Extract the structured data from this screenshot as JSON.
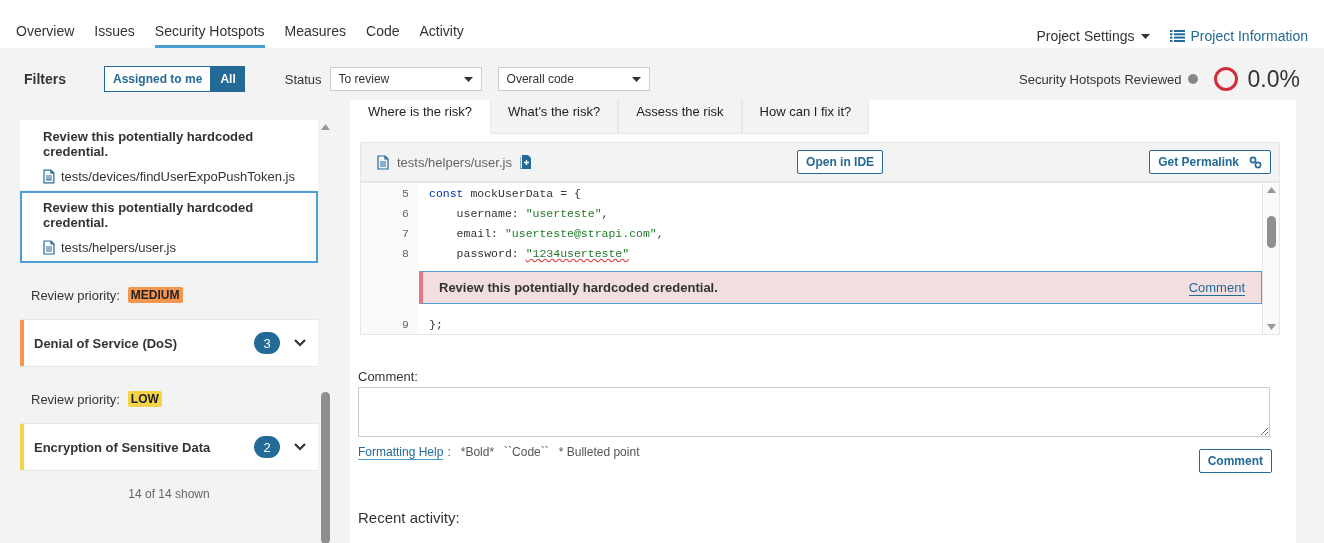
{
  "nav": {
    "tabs": [
      {
        "label": "Overview",
        "selected": false
      },
      {
        "label": "Issues",
        "selected": false
      },
      {
        "label": "Security Hotspots",
        "selected": true
      },
      {
        "label": "Measures",
        "selected": false
      },
      {
        "label": "Code",
        "selected": false
      },
      {
        "label": "Activity",
        "selected": false
      }
    ],
    "settings": "Project Settings",
    "info": "Project Information"
  },
  "filters": {
    "title": "Filters",
    "assignment": [
      {
        "label": "Assigned to me",
        "selected": false
      },
      {
        "label": "All",
        "selected": true
      }
    ],
    "status_label": "Status",
    "status": "To review",
    "scope": "Overall code",
    "reviewed_label": "Security Hotspots Reviewed",
    "reviewed_value": "0.0%"
  },
  "sidebar": {
    "items": [
      {
        "kind": "hotspot",
        "title": "Review this potentially hardcoded credential.",
        "file": "tests/devices/findUserExpoPushToken.js",
        "selected": false
      },
      {
        "kind": "hotspot",
        "title": "Review this potentially hardcoded credential.",
        "file": "tests/helpers/user.js",
        "selected": true
      },
      {
        "kind": "priority",
        "label": "Review priority:",
        "level": "MEDIUM",
        "color": "#f4964d"
      },
      {
        "kind": "category",
        "title": "Denial of Service (DoS)",
        "count": "3",
        "color": "#f4964d"
      },
      {
        "kind": "priority",
        "label": "Review priority:",
        "level": "LOW",
        "color": "#f4d348"
      },
      {
        "kind": "category",
        "title": "Encryption of Sensitive Data",
        "count": "2",
        "color": "#f4d348"
      }
    ],
    "footer": "14 of 14 shown"
  },
  "detail": {
    "tabs": [
      {
        "label": "Where is the risk?",
        "selected": true
      },
      {
        "label": "What's the risk?",
        "selected": false
      },
      {
        "label": "Assess the risk",
        "selected": false
      },
      {
        "label": "How can I fix it?",
        "selected": false
      }
    ],
    "file": "tests/helpers/user.js",
    "open_ide": "Open in IDE",
    "permalink": "Get Permalink",
    "code": [
      {
        "kind": "line",
        "number": "5",
        "tokens": [
          {
            "kind": "keyword",
            "text": "const"
          },
          {
            "kind": "plain",
            "text": " mockUserData = {"
          }
        ]
      },
      {
        "kind": "line",
        "number": "6",
        "tokens": [
          {
            "kind": "plain",
            "text": "    username: "
          },
          {
            "kind": "string",
            "text": "\"userteste\""
          },
          {
            "kind": "plain",
            "text": ","
          }
        ]
      },
      {
        "kind": "line",
        "number": "7",
        "tokens": [
          {
            "kind": "plain",
            "text": "    email: "
          },
          {
            "kind": "string",
            "text": "\"userteste@strapi.com\""
          },
          {
            "kind": "plain",
            "text": ","
          }
        ]
      },
      {
        "kind": "line",
        "number": "8",
        "tokens": [
          {
            "kind": "plain",
            "text": "    password: "
          },
          {
            "kind": "flagged",
            "text": "\"1234userteste\""
          }
        ]
      },
      {
        "kind": "issue",
        "message": "Review this potentially hardcoded credential.",
        "action": "Comment"
      },
      {
        "kind": "line",
        "number": "9",
        "tokens": [
          {
            "kind": "plain",
            "text": "};"
          }
        ]
      }
    ],
    "comment_label": "Comment:",
    "formatting_help": "Formatting Help",
    "formatting_hint": ":   *Bold*   ``Code``   * Bulleted point",
    "comment_button": "Comment",
    "recent_activity": "Recent activity:"
  }
}
